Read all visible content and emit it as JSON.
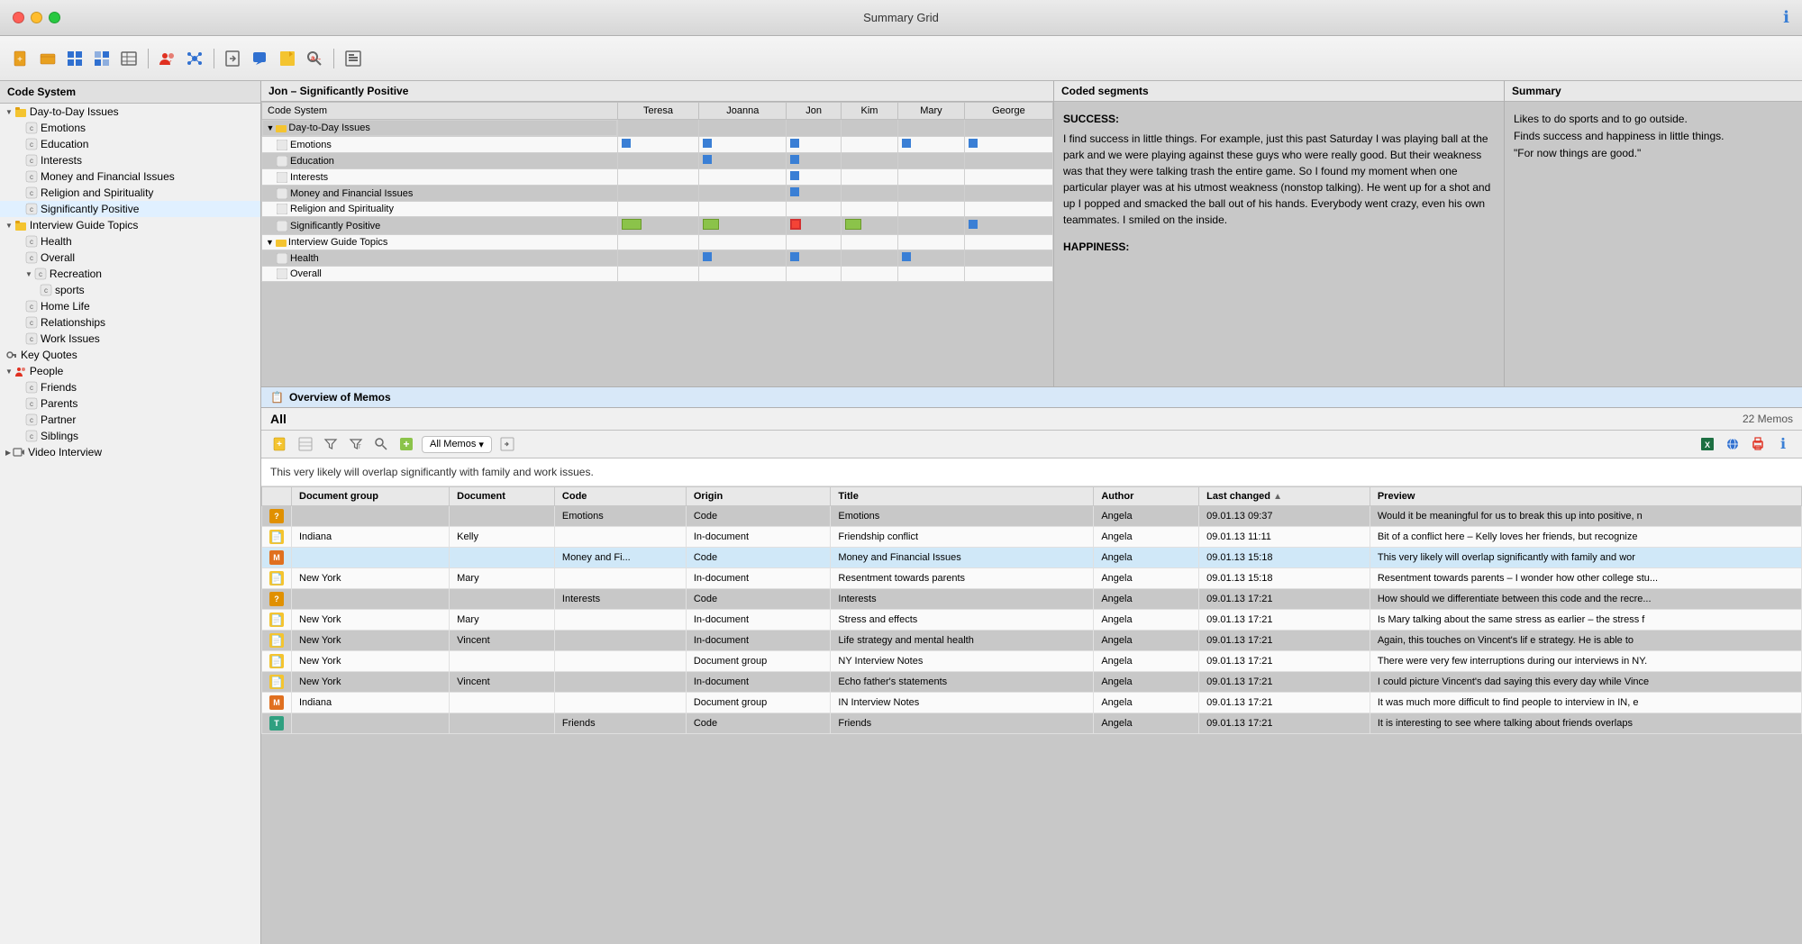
{
  "titleBar": {
    "title": "Summary Grid",
    "trafficLights": [
      "red",
      "yellow",
      "green"
    ]
  },
  "headerBar": {
    "label": "Jon – Significantly Positive"
  },
  "codeSystem": {
    "label": "Code System",
    "columns": [
      "Teresa",
      "Joanna",
      "Jon",
      "Kim",
      "Mary",
      "George"
    ],
    "items": [
      {
        "level": 0,
        "label": "Day-to-Day Issues",
        "hasArrow": true,
        "icon": "folder",
        "children": [
          {
            "level": 1,
            "label": "Emotions",
            "icon": "code"
          },
          {
            "level": 1,
            "label": "Education",
            "icon": "code"
          },
          {
            "level": 1,
            "label": "Interests",
            "icon": "code"
          },
          {
            "level": 1,
            "label": "Money and Financial Issues",
            "icon": "code"
          },
          {
            "level": 1,
            "label": "Religion and Spirituality",
            "icon": "code"
          },
          {
            "level": 1,
            "label": "Significantly Positive",
            "icon": "code",
            "highlighted": true
          }
        ]
      },
      {
        "level": 0,
        "label": "Interview Guide Topics",
        "hasArrow": true,
        "icon": "folder",
        "children": [
          {
            "level": 1,
            "label": "Health",
            "icon": "code"
          },
          {
            "level": 1,
            "label": "Overall",
            "icon": "code"
          },
          {
            "level": 1,
            "label": "Recreation",
            "icon": "code",
            "hasArrow": true,
            "children": [
              {
                "level": 2,
                "label": "sports",
                "icon": "code"
              }
            ]
          },
          {
            "level": 1,
            "label": "Home Life",
            "icon": "code"
          },
          {
            "level": 1,
            "label": "Relationships",
            "icon": "code"
          },
          {
            "level": 1,
            "label": "Work Issues",
            "icon": "code"
          }
        ]
      },
      {
        "level": 0,
        "label": "Key Quotes",
        "icon": "key"
      },
      {
        "level": 0,
        "label": "People",
        "hasArrow": true,
        "icon": "people",
        "children": [
          {
            "level": 1,
            "label": "Friends",
            "icon": "code"
          },
          {
            "level": 1,
            "label": "Parents",
            "icon": "code"
          },
          {
            "level": 1,
            "label": "Partner",
            "icon": "code"
          },
          {
            "level": 1,
            "label": "Siblings",
            "icon": "code"
          }
        ]
      },
      {
        "level": 0,
        "label": "Video Interview",
        "icon": "video"
      }
    ]
  },
  "codedSegments": {
    "header": "Coded segments",
    "sections": [
      {
        "title": "SUCCESS:",
        "text": "I find success in little things.  For example, just this past Saturday I was playing ball at the park and we were playing against these guys who were really good.  But their weakness was that they were talking trash the entire game.  So I found my moment when one particular player was at his utmost weakness (nonstop talking).  He went up for a shot and up I popped and smacked the ball out of his hands.  Everybody went crazy, even his own teammates.  I smiled on the inside."
      },
      {
        "title": "HAPPINESS:",
        "text": ""
      }
    ]
  },
  "summary": {
    "header": "Summary",
    "text": "Likes to do sports and to go outside.\nFinds success and happiness in little things.\n\"For now things are good.\""
  },
  "memosBar": {
    "label": "Overview of Memos",
    "icon": "📋"
  },
  "memosToolbar": {
    "allLabel": "All",
    "count": "22 Memos",
    "filterLabel": "All Memos"
  },
  "memosPreview": {
    "text": "This very likely will overlap significantly with family and work issues."
  },
  "memosTable": {
    "columns": [
      {
        "key": "icon",
        "label": ""
      },
      {
        "key": "documentGroup",
        "label": "Document group"
      },
      {
        "key": "document",
        "label": "Document"
      },
      {
        "key": "code",
        "label": "Code"
      },
      {
        "key": "origin",
        "label": "Origin"
      },
      {
        "key": "title",
        "label": "Title"
      },
      {
        "key": "author",
        "label": "Author"
      },
      {
        "key": "lastChanged",
        "label": "Last changed"
      },
      {
        "key": "preview",
        "label": "Preview"
      }
    ],
    "rows": [
      {
        "badge": "?",
        "badgeType": "badge-question",
        "documentGroup": "",
        "document": "",
        "code": "Emotions",
        "origin": "Code",
        "title": "Emotions",
        "author": "Angela",
        "lastChanged": "09.01.13 09:37",
        "preview": "Would it be meaningful for us to break this up into positive, n"
      },
      {
        "badge": "📄",
        "badgeType": "badge-yellow",
        "documentGroup": "Indiana",
        "document": "Kelly",
        "code": "",
        "origin": "In-document",
        "title": "Friendship conflict",
        "author": "Angela",
        "lastChanged": "09.01.13 11:11",
        "preview": "Bit of a conflict here – Kelly loves her friends, but recognize"
      },
      {
        "badge": "M",
        "badgeType": "badge-orange",
        "documentGroup": "",
        "document": "",
        "code": "Money and Fi...",
        "origin": "Code",
        "title": "Money and Financial Issues",
        "author": "Angela",
        "lastChanged": "09.01.13 15:18",
        "preview": "This very likely will overlap significantly with family and wor",
        "selected": true
      },
      {
        "badge": "📄",
        "badgeType": "badge-yellow",
        "documentGroup": "New York",
        "document": "Mary",
        "code": "",
        "origin": "In-document",
        "title": "Resentment towards parents",
        "author": "Angela",
        "lastChanged": "09.01.13 15:18",
        "preview": "Resentment towards parents – I wonder how other college stu..."
      },
      {
        "badge": "?",
        "badgeType": "badge-question",
        "documentGroup": "",
        "document": "",
        "code": "Interests",
        "origin": "Code",
        "title": "Interests",
        "author": "Angela",
        "lastChanged": "09.01.13 17:21",
        "preview": "How should we differentiate between this code and the recre..."
      },
      {
        "badge": "📄",
        "badgeType": "badge-yellow",
        "documentGroup": "New York",
        "document": "Mary",
        "code": "",
        "origin": "In-document",
        "title": "Stress and effects",
        "author": "Angela",
        "lastChanged": "09.01.13 17:21",
        "preview": "Is Mary talking about the same stress as earlier – the stress f"
      },
      {
        "badge": "📄",
        "badgeType": "badge-yellow",
        "documentGroup": "New York",
        "document": "Vincent",
        "code": "",
        "origin": "In-document",
        "title": "Life strategy and mental health",
        "author": "Angela",
        "lastChanged": "09.01.13 17:21",
        "preview": "Again, this touches on Vincent's lif e strategy.  He is able to"
      },
      {
        "badge": "📄",
        "badgeType": "badge-yellow",
        "documentGroup": "New York",
        "document": "",
        "code": "",
        "origin": "Document group",
        "title": "NY Interview Notes",
        "author": "Angela",
        "lastChanged": "09.01.13 17:21",
        "preview": "There were very few interruptions during our interviews in NY."
      },
      {
        "badge": "📄",
        "badgeType": "badge-yellow",
        "documentGroup": "New York",
        "document": "Vincent",
        "code": "",
        "origin": "In-document",
        "title": "Echo father's statements",
        "author": "Angela",
        "lastChanged": "09.01.13 17:21",
        "preview": "I could picture Vincent's dad saying this every day while Vince"
      },
      {
        "badge": "M",
        "badgeType": "badge-orange",
        "documentGroup": "Indiana",
        "document": "",
        "code": "",
        "origin": "Document group",
        "title": "IN Interview Notes",
        "author": "Angela",
        "lastChanged": "09.01.13 17:21",
        "preview": "It was much more difficult to find people to interview in IN, e"
      },
      {
        "badge": "T",
        "badgeType": "badge-teal",
        "documentGroup": "",
        "document": "",
        "code": "Friends",
        "origin": "Code",
        "title": "Friends",
        "author": "Angela",
        "lastChanged": "09.01.13 17:21",
        "preview": "It is interesting to see where talking about friends overlaps"
      }
    ]
  }
}
